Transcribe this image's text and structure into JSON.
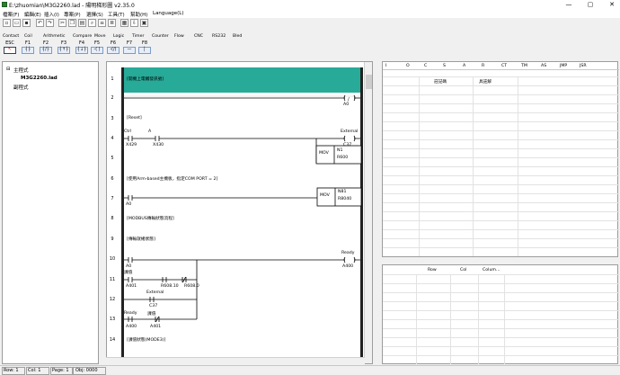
{
  "window": {
    "title": "E:\\zhuomian\\M3G2260.lad - 陽明梯形圖 v2.35.0",
    "min_glyph": "—",
    "max_glyph": "▢",
    "close_glyph": "✕"
  },
  "menu": [
    "檔案(F)",
    "編輯(E)",
    "插入(I)",
    "專案(P)",
    "選擇(S)",
    "工具(T)",
    "幫助(H)",
    "Language(L)"
  ],
  "ladder_tabs": [
    "Contact",
    "Coil",
    "Arithmetic",
    "Compare",
    "Move",
    "Logic",
    "Timer",
    "Counter",
    "Flow",
    "CNC",
    "RS232",
    "Bled"
  ],
  "fkeys": [
    {
      "label": "ESC",
      "sym": "↖"
    },
    {
      "label": "F1",
      "sym": "┤├"
    },
    {
      "label": "F2",
      "sym": "┤/├"
    },
    {
      "label": "F3",
      "sym": "┤↑├"
    },
    {
      "label": "F4",
      "sym": "┤↓├"
    },
    {
      "label": "F5",
      "sym": "-( )"
    },
    {
      "label": "F6",
      "sym": "-(/)"
    },
    {
      "label": "F7",
      "sym": "—"
    },
    {
      "label": "F8",
      "sym": "│"
    }
  ],
  "tree": {
    "root": "主程式",
    "file": "M3G2260.lad",
    "sub": "副程式"
  },
  "ladder": {
    "rungs": [
      "1",
      "2",
      "3",
      "4",
      "5",
      "6",
      "7",
      "8",
      "9",
      "10",
      "11",
      "12",
      "13",
      "14"
    ],
    "comment1": "[開機上電觸發訊號]",
    "coil_a0": "A0",
    "reset": "[Reset]",
    "ctrl": "Ctrl",
    "a_label": "A",
    "x429": "X429",
    "x430": "X430",
    "external": "External",
    "c37": "C37",
    "mov": "MOV",
    "n1": "N1",
    "r600": "R600",
    "comment6": "[使用Arm-based主機板，指定COM PORT = 2]",
    "a0b": "A0",
    "n81": "N81",
    "r8040": "R8040",
    "comment8": "[MODBUS傳輸狀態流程]",
    "comment9": "[傳輸就緒狀態]",
    "ready": "Ready",
    "a400": "A400",
    "a0c": "A0",
    "keyin": "課值",
    "a401": "A401",
    "r60810": "R608.10",
    "r6080": "R608.0",
    "external2": "External",
    "c37b": "C37",
    "ready2": "Ready",
    "keyin2": "課值",
    "a400b": "A400",
    "a401b": "A401",
    "comment14": "[課值狀態(MODE3)]"
  },
  "right_top": {
    "cols": [
      "I",
      "O",
      "C",
      "S",
      "A",
      "R",
      "CT",
      "TM",
      "AS",
      "JMP",
      "JSR"
    ],
    "h1": "註記碼",
    "h2": "具註解"
  },
  "right_bot": {
    "cols": [
      "Row",
      "Col",
      "Colum..."
    ]
  },
  "status": {
    "row": "Row: 1",
    "col": "Col: 1",
    "page": "Page: 1",
    "obj": "Obj: 0000"
  }
}
